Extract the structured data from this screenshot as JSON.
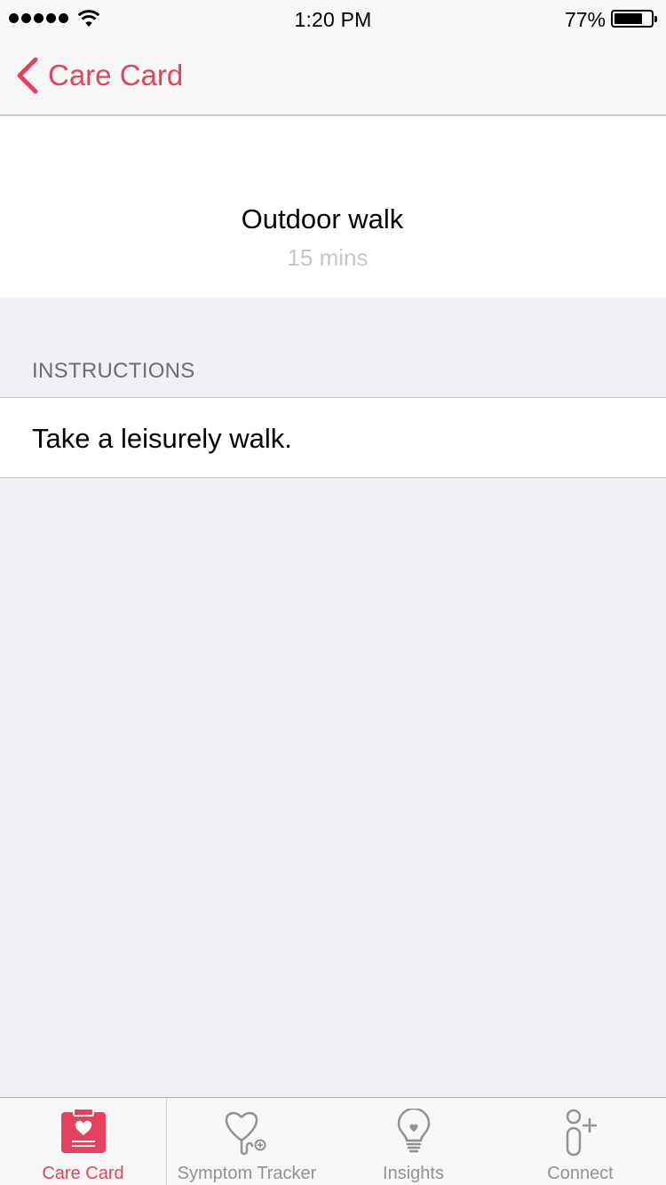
{
  "status_bar": {
    "time": "1:20 PM",
    "battery_percent": "77%",
    "battery_level": 0.77,
    "signal_bars": 5
  },
  "nav": {
    "back_label": "Care Card",
    "accent_color": "#e8415e"
  },
  "activity": {
    "title": "Outdoor walk",
    "subtitle": "15 mins"
  },
  "instructions": {
    "header": "INSTRUCTIONS",
    "text": "Take a leisurely walk."
  },
  "tabs": [
    {
      "label": "Care Card",
      "icon": "care-card-icon",
      "active": true
    },
    {
      "label": "Symptom Tracker",
      "icon": "stethoscope-icon",
      "active": false
    },
    {
      "label": "Insights",
      "icon": "lightbulb-icon",
      "active": false
    },
    {
      "label": "Connect",
      "icon": "connect-icon",
      "active": false
    }
  ]
}
